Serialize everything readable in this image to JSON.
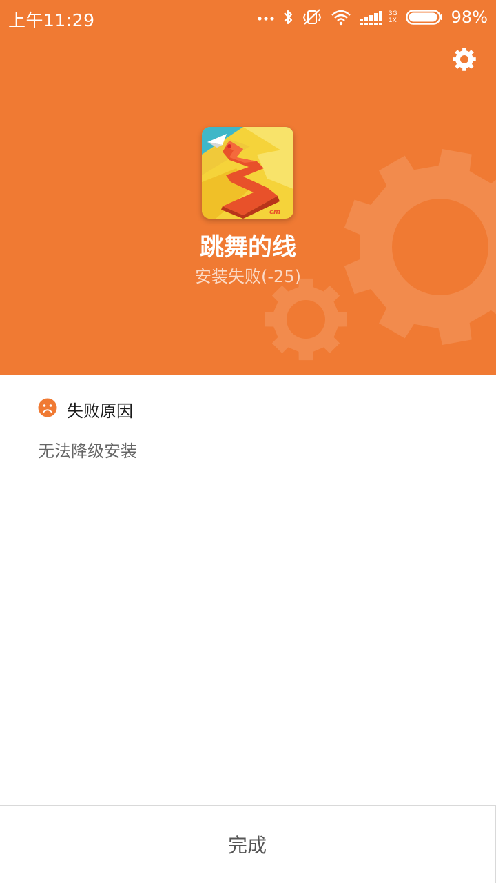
{
  "colors": {
    "accent": "#F07A33",
    "white": "#FFFFFF",
    "reason_icon": "#F07A33"
  },
  "status_bar": {
    "time": "上午11:29",
    "network_type_top": "3G",
    "network_type_bottom": "1X",
    "battery": "98%",
    "battery_level": 0.98,
    "icons": [
      "more-dots-icon",
      "bluetooth-icon",
      "vibrate-off-icon",
      "wifi-icon",
      "signal-icon",
      "battery-icon"
    ]
  },
  "header": {
    "settings_icon": "gear-icon",
    "app_icon": "dancing-line-app-icon",
    "app_name": "跳舞的线",
    "install_status": "安装失败(-25)"
  },
  "reason": {
    "icon": "sad-face-icon",
    "title": "失败原因",
    "text": "无法降级安装"
  },
  "footer": {
    "done_label": "完成"
  }
}
